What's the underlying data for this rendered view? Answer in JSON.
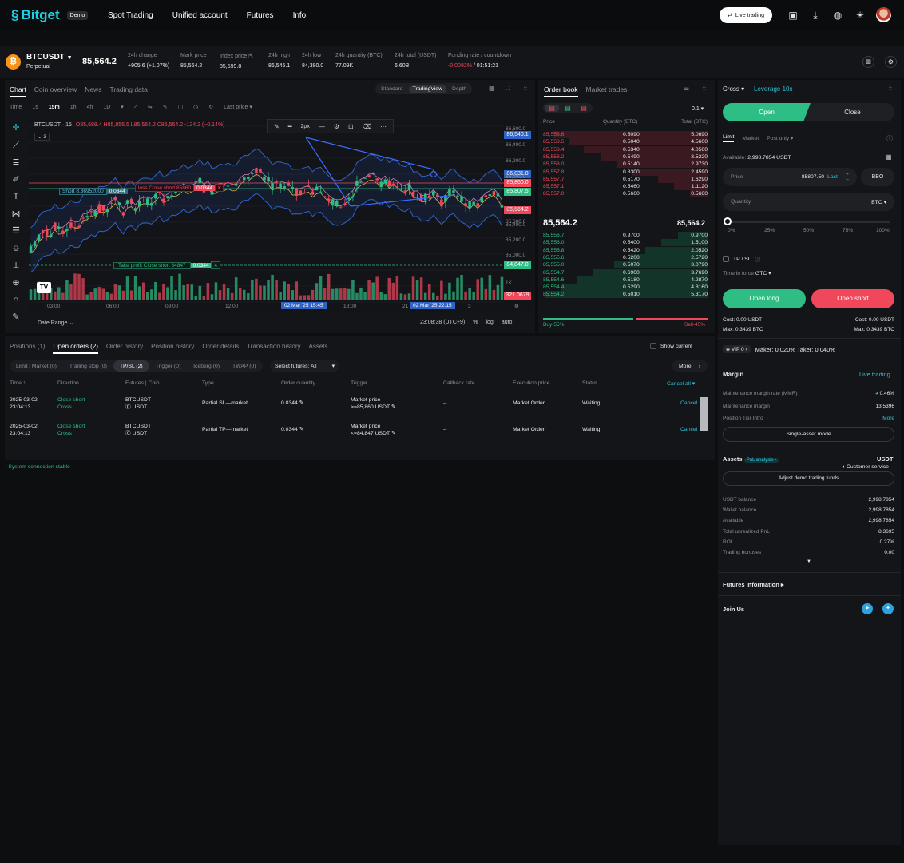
{
  "brand": {
    "name": "Bitget",
    "demo_badge": "Demo"
  },
  "nav": [
    "Spot Trading",
    "Unified account",
    "Futures",
    "Info"
  ],
  "top_actions": {
    "live_trading": "Live trading"
  },
  "ticker": {
    "symbol": "BTCUSDT",
    "type": "Perpetual",
    "price": "85,564.2"
  },
  "stats": [
    {
      "label": "24h change",
      "value": "+905.6 (+1.07%)"
    },
    {
      "label": "Mark price",
      "value": "85,564.2"
    },
    {
      "label": "Index price",
      "value": "85,599.8"
    },
    {
      "label": "24h high",
      "value": "86,545.1"
    },
    {
      "label": "24h low",
      "value": "84,380.0"
    },
    {
      "label": "24h quantity (BTC)",
      "value": "77.09K"
    },
    {
      "label": "24h total (USDT)",
      "value": "6.60B"
    },
    {
      "label": "Funding rate / countdown",
      "value_a": "-0.0082%",
      "value_b": "/ 01:51:21"
    }
  ],
  "chart_panel": {
    "tabs": [
      "Chart",
      "Coin overview",
      "News",
      "Trading data"
    ],
    "views": [
      "Standard",
      "TradingView",
      "Depth"
    ],
    "intervals": [
      "Time",
      "1s",
      "15m",
      "1h",
      "4h",
      "1D"
    ],
    "last_price": "Last price ▾",
    "legend": "BTCUSDT · 15",
    "ohlc": "O85,688.4 H85,856.5 L85,564.2 C85,564.2 -124.2 (−0.14%)",
    "indicator_count": "3",
    "stroke": "2px",
    "short_label": "Short 8.36952000",
    "short_qty": "0.0344",
    "sl_label": "loss Close short 85860",
    "sl_qty": "0.0344",
    "tp_label": "Take profit Close short 84847",
    "tp_qty": "0.0344",
    "price_axis": [
      "86,600.0",
      "86,400.0",
      "86,200.0",
      "86,000.0",
      "85,800.0",
      "85,600.0",
      "85,400.0",
      "85,200.0",
      "85,000.0",
      "1K"
    ],
    "price_flags": {
      "p1": "86,540.1",
      "p2": "86,031.8",
      "p3": "85,860.0",
      "p4": "85,807.5",
      "p5": "85,564.2",
      "p6": "84,847.0",
      "p7": "321.0679"
    },
    "time_axis": [
      "03:00",
      "06:00",
      "09:00",
      "12:00",
      "18:00",
      "21",
      "3"
    ],
    "time_flag_a": "02 Mar '25   15:45",
    "time_flag_b": "02 Mar '25   22:15",
    "date_range": "Date Range ⌄",
    "clock": "23:08:38 (UTC+9)",
    "scale_opts": [
      "%",
      "log",
      "auto"
    ]
  },
  "order_book": {
    "tabs": [
      "Order book",
      "Market trades"
    ],
    "step": "0.1 ▾",
    "headers": [
      "Price",
      "Quantity (BTC)",
      "Total (BTC)"
    ],
    "asks": [
      [
        "85,558.6",
        "0.5090",
        "5.0690"
      ],
      [
        "85,558.5",
        "0.5040",
        "4.5600"
      ],
      [
        "85,558.4",
        "0.5340",
        "4.0560"
      ],
      [
        "85,558.2",
        "0.5490",
        "3.5220"
      ],
      [
        "85,558.0",
        "0.5140",
        "2.9730"
      ],
      [
        "85,557.8",
        "0.8300",
        "2.4590"
      ],
      [
        "85,557.7",
        "0.5170",
        "1.6290"
      ],
      [
        "85,557.1",
        "0.5460",
        "1.1120"
      ],
      [
        "85,557.0",
        "0.5660",
        "0.5660"
      ]
    ],
    "mid_price": "85,564.2",
    "mid_mark": "85,564.2",
    "bids": [
      [
        "85,556.7",
        "0.9700",
        "0.9700"
      ],
      [
        "85,556.0",
        "0.5400",
        "1.5100"
      ],
      [
        "85,555.8",
        "0.5420",
        "2.0520"
      ],
      [
        "85,555.6",
        "0.5200",
        "2.5720"
      ],
      [
        "85,555.0",
        "0.5070",
        "3.0790"
      ],
      [
        "85,554.7",
        "0.6900",
        "3.7690"
      ],
      [
        "85,554.6",
        "0.5180",
        "4.2870"
      ],
      [
        "85,554.4",
        "0.5290",
        "4.8160"
      ],
      [
        "85,554.2",
        "0.5010",
        "5.3170"
      ]
    ],
    "buy_pct": "Buy-55%",
    "sell_pct": "Sell-45%"
  },
  "orders": {
    "tabs": [
      "Positions (1)",
      "Open orders (2)",
      "Order history",
      "Position history",
      "Order details",
      "Transaction history",
      "Assets"
    ],
    "show_current": "Show current",
    "subtabs": [
      "Limit | Market (0)",
      "Trailing stop (0)",
      "TP/SL (2)",
      "Trigger (0)",
      "Iceberg (0)",
      "TWAP (0)"
    ],
    "select_futures": "Select futures: All",
    "more": "More",
    "headers": [
      "Time ↕",
      "Direction",
      "Futures | Coin",
      "Type",
      "Order quantity",
      "Trigger",
      "Callback rate",
      "Execution price",
      "Status",
      "Cancel all ▾"
    ],
    "rows": [
      {
        "date": "2025-03-02",
        "time": "23:04:13",
        "dir": "Close short",
        "mode": "Cross",
        "sym": "BTCUSDT",
        "coin": "USDT",
        "type": "Partial SL—market",
        "qty": "0.0344",
        "trig_a": "Market price",
        "trig_b": ">=85,860 USDT",
        "callback": "--",
        "exec": "Market Order",
        "status": "Waiting",
        "action": "Cancel"
      },
      {
        "date": "2025-03-02",
        "time": "23:04:13",
        "dir": "Close short",
        "mode": "Cross",
        "sym": "BTCUSDT",
        "coin": "USDT",
        "type": "Partial TP—market",
        "qty": "0.0344",
        "trig_a": "Market price",
        "trig_b": "<=84,847 USDT",
        "callback": "--",
        "exec": "Market Order",
        "status": "Waiting",
        "action": "Cancel"
      }
    ],
    "status_msg": "System connection stable"
  },
  "trade": {
    "margin_mode": "Cross ▾",
    "leverage": "Leverage 10x",
    "open": "Open",
    "close": "Close",
    "types": [
      "Limit",
      "Market",
      "Post only ▾"
    ],
    "available_label": "Available:",
    "available": "2,998.7854 USDT",
    "price_label": "Price",
    "price_value": "85807.50",
    "price_last": "Last",
    "bbo": "BBO",
    "qty_label": "Quantity",
    "qty_unit": "BTC ▾",
    "slider_marks": [
      "0%",
      "25%",
      "50%",
      "75%",
      "100%"
    ],
    "slider_value": 0,
    "tpsl": "TP / SL",
    "tif_label": "Time in force",
    "tif": "GTC ▾",
    "open_long": "Open long",
    "open_short": "Open short",
    "cost_long": "Cost: 0.00 USDT",
    "max_long": "Max: 0.3439 BTC",
    "cost_short": "Cost: 0.00 USDT",
    "max_short": "Max: 0.3439 BTC",
    "vip": "VIP 0 ›",
    "fees": "Maker: 0.020%  Taker: 0.040%",
    "margin_title": "Margin",
    "live_trading": "Live trading",
    "mmr_label": "Maintenance margin rate (MMR)",
    "mmr": "0.46%",
    "mm_label": "Maintenance margin",
    "mm": "13.5396",
    "tier_label": "Position Tier Intro",
    "tier_more": "More",
    "single_asset": "Single-asset mode",
    "assets_title": "Assets",
    "pnl": "PnL analysis ›",
    "assets_coin": "USDT",
    "customer_service": "Customer service",
    "adjust": "Adjust demo trading funds",
    "balances": [
      [
        "USDT balance",
        "2,998.7854"
      ],
      [
        "Wallet balance",
        "2,998.7854"
      ],
      [
        "Available",
        "2,998.7854"
      ],
      [
        "Total unrealized PnL",
        "8.3695"
      ],
      [
        "ROI",
        "0.27%"
      ],
      [
        "Trading bonuses",
        "0.00"
      ]
    ],
    "futures_info": "Futures Information ▸",
    "join": "Join Us"
  },
  "colors": {
    "accent": "#1fd0e2",
    "green": "#2ebd85",
    "red": "#f0475b"
  }
}
